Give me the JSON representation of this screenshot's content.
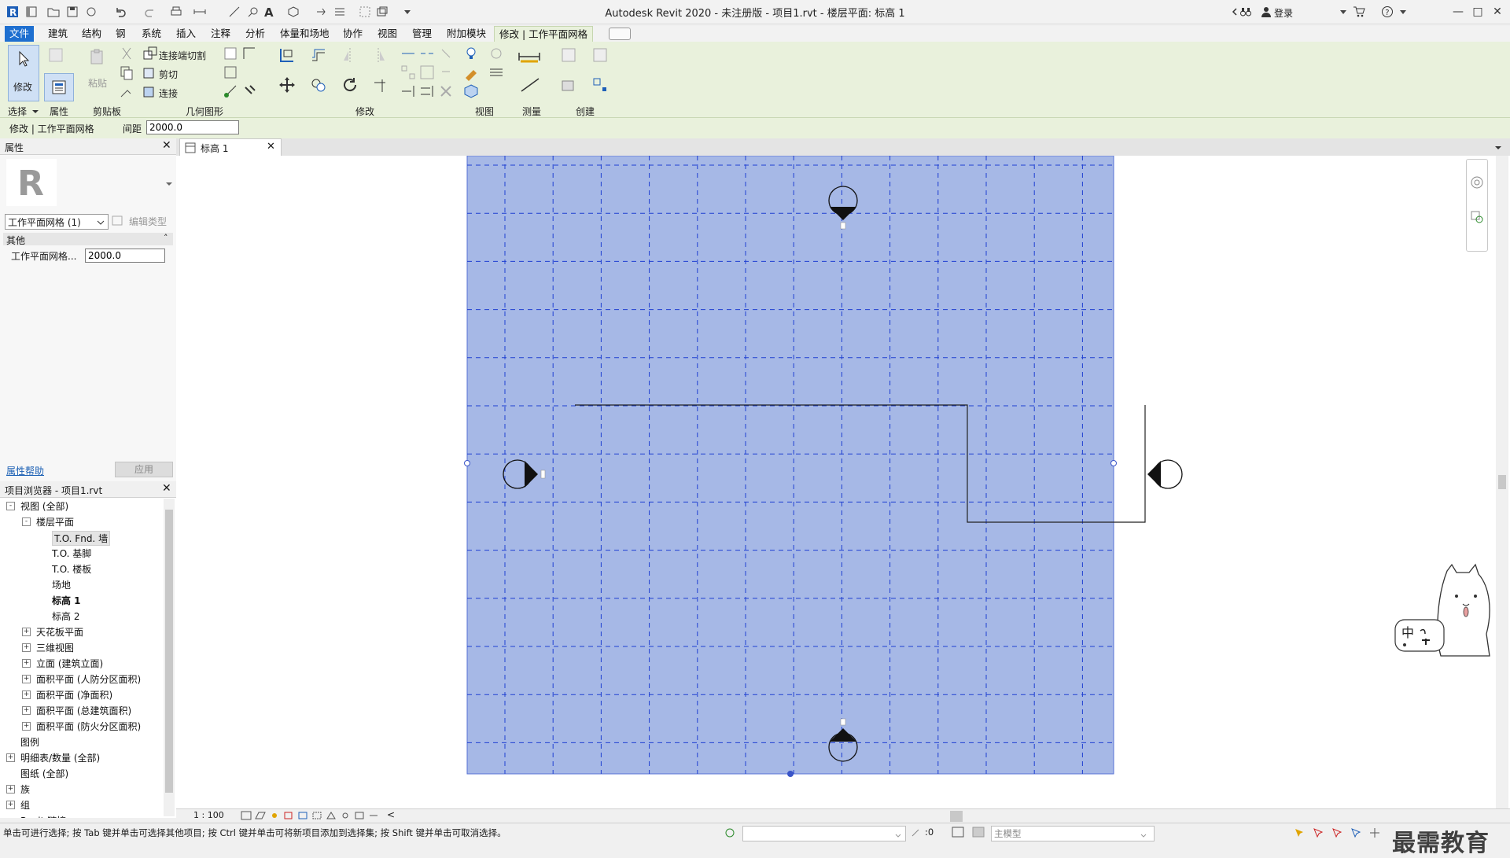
{
  "window": {
    "title": "Autodesk Revit 2020 - 未注册版 - 项目1.rvt - 楼层平面: 标高 1",
    "login_label": "登录"
  },
  "menu": {
    "items": [
      "文件",
      "建筑",
      "结构",
      "钢",
      "系统",
      "插入",
      "注释",
      "分析",
      "体量和场地",
      "协作",
      "视图",
      "管理",
      "附加模块",
      "修改 | 工作平面网格"
    ]
  },
  "ribbon": {
    "modify_label": "修改",
    "paste_label": "粘贴",
    "join_cut_label": "连接端切割",
    "cut_label": "剪切",
    "join_label": "连接",
    "panels": {
      "select": "选择",
      "properties": "属性",
      "clipboard": "剪贴板",
      "geometry": "几何图形",
      "modify": "修改",
      "view": "视图",
      "measure": "测量",
      "create": "创建"
    }
  },
  "options_bar": {
    "context": "修改 | 工作平面网格",
    "spacing_label": "间距",
    "spacing_value": "2000.0"
  },
  "properties": {
    "title": "属性",
    "type_selector": "工作平面网格 (1)",
    "edit_type": "编辑类型",
    "group": "其他",
    "param_name": "工作平面网格...",
    "param_value": "2000.0",
    "help_link": "属性帮助",
    "apply": "应用"
  },
  "browser": {
    "title": "项目浏览器 - 项目1.rvt",
    "items": [
      {
        "label": "视图 (全部)",
        "level": 0,
        "toggle": "-"
      },
      {
        "label": "楼层平面",
        "level": 1,
        "toggle": "-"
      },
      {
        "label": "T.O. Fnd. 墙",
        "level": 2,
        "toggle": "",
        "selected": true
      },
      {
        "label": "T.O. 基脚",
        "level": 2,
        "toggle": ""
      },
      {
        "label": "T.O. 楼板",
        "level": 2,
        "toggle": ""
      },
      {
        "label": "场地",
        "level": 2,
        "toggle": ""
      },
      {
        "label": "标高 1",
        "level": 2,
        "toggle": "",
        "bold": true
      },
      {
        "label": "标高 2",
        "level": 2,
        "toggle": ""
      },
      {
        "label": "天花板平面",
        "level": 1,
        "toggle": "+"
      },
      {
        "label": "三维视图",
        "level": 1,
        "toggle": "+"
      },
      {
        "label": "立面 (建筑立面)",
        "level": 1,
        "toggle": "+"
      },
      {
        "label": "面积平面 (人防分区面积)",
        "level": 1,
        "toggle": "+"
      },
      {
        "label": "面积平面 (净面积)",
        "level": 1,
        "toggle": "+"
      },
      {
        "label": "面积平面 (总建筑面积)",
        "level": 1,
        "toggle": "+"
      },
      {
        "label": "面积平面 (防火分区面积)",
        "level": 1,
        "toggle": "+"
      },
      {
        "label": "图例",
        "level": 0,
        "toggle": ""
      },
      {
        "label": "明细表/数量 (全部)",
        "level": 0,
        "toggle": "+"
      },
      {
        "label": "图纸 (全部)",
        "level": 0,
        "toggle": ""
      },
      {
        "label": "族",
        "level": 0,
        "toggle": "+"
      },
      {
        "label": "组",
        "level": 0,
        "toggle": "+"
      },
      {
        "label": "Revit 链接",
        "level": 0,
        "toggle": ""
      }
    ]
  },
  "view_tab": {
    "label": "标高 1"
  },
  "view_bar": {
    "scale": "1 : 100"
  },
  "status": {
    "message": "单击可进行选择; 按 Tab 键并单击可选择其他项目; 按 Ctrl 键并单击可将新项目添加到选择集; 按 Shift 键并单击可取消选择。",
    "selection_count": ":0",
    "main_model": "主模型"
  },
  "mascot": {
    "ime_label": "中"
  },
  "watermark": "最需教育",
  "colors": {
    "grid_fill": "#a6b8e6",
    "grid_line": "#1f3fd1",
    "ribbon_bg": "#e9f1dc",
    "file_tab": "#1e6fd0"
  }
}
